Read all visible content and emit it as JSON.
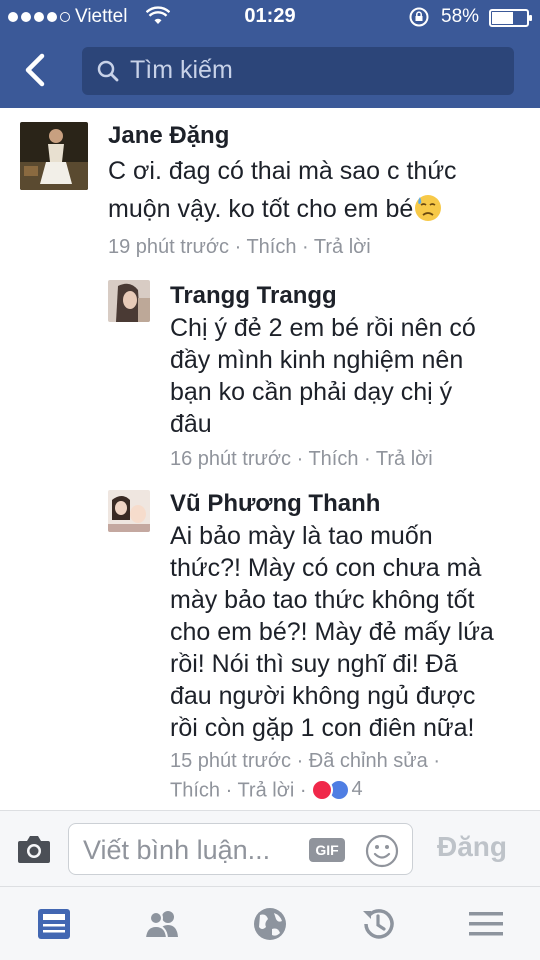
{
  "status": {
    "carrier": "Viettel",
    "time": "01:29",
    "battery_text": "58%",
    "battery_level": 0.58
  },
  "header": {
    "search_placeholder": "Tìm kiếm"
  },
  "comments": [
    {
      "author": "Jane Đặng",
      "text_line1": "C ơi. đag có thai mà sao c thức",
      "text_line2": "muộn vậy. ko tốt cho em bé",
      "emoji": "sad-sweat-emoji",
      "time": "19 phút trước",
      "like": "Thích",
      "reply": "Trả lời"
    },
    {
      "author": "Trangg Trangg",
      "lines": [
        "Chị ý đẻ 2 em bé rồi nên có",
        "đầy mình kinh nghiệm nên",
        "bạn ko cần phải dạy chị ý",
        "đâu"
      ],
      "time": "16 phút trước",
      "like": "Thích",
      "reply": "Trả lời"
    },
    {
      "author": "Vũ Phương Thanh",
      "lines": [
        "Ai bảo mày là tao muốn",
        "thức?! Mày có con chưa mà",
        "mày bảo tao thức không tốt",
        "cho em bé?! Mày đẻ mấy lứa",
        "rồi! Nói thì suy nghĩ đi! Đã",
        "đau người không ngủ được",
        "rồi còn gặp 1 con điên nữa!"
      ],
      "time": "15 phút trước",
      "edited": "Đã chỉnh sửa",
      "like": "Thích",
      "reply": "Trả lời",
      "reaction_count": "4"
    }
  ],
  "composer": {
    "placeholder": "Viết bình luận...",
    "gif_label": "GIF",
    "post_label": "Đăng"
  },
  "colors": {
    "brand": "#3b5998",
    "search_bg": "#2c4579",
    "meta": "#90949c",
    "love": "#f0284a",
    "like": "#4f7ee3"
  },
  "navbar": {
    "icons": [
      "news-feed-icon",
      "friends-icon",
      "globe-icon",
      "history-icon",
      "menu-icon"
    ]
  }
}
